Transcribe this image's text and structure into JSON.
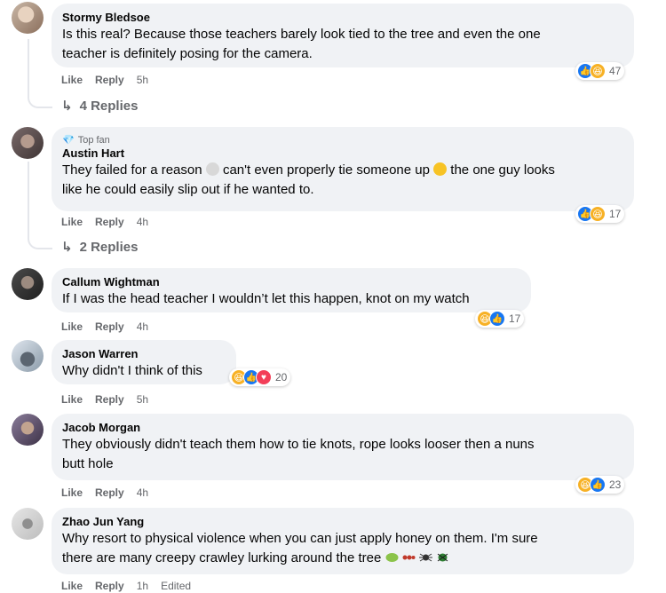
{
  "comments": [
    {
      "author": "Stormy Bledsoe",
      "lines": [
        "Is this real? Because those teachers barely look tied to the tree and even the one",
        "teacher is definitely posing for the camera."
      ],
      "like": "Like",
      "reply": "Reply",
      "time": "5h",
      "reaction_count": "47",
      "reactions": [
        "like-reaction",
        "haha-reaction"
      ],
      "replies": "4 Replies"
    },
    {
      "badge": "Top fan",
      "author": "Austin Hart",
      "line1_a": "They failed for a reason",
      "line1_b": "can't even properly tie someone up",
      "line1_c": "the one guy looks",
      "line2": "like he could easily slip out if he wanted to.",
      "like": "Like",
      "reply": "Reply",
      "time": "4h",
      "reaction_count": "17",
      "reactions": [
        "like-reaction",
        "haha-reaction"
      ],
      "replies": "2 Replies"
    },
    {
      "author": "Callum Wightman",
      "text": "If I was the head teacher I wouldn’t let this happen, knot on my watch",
      "like": "Like",
      "reply": "Reply",
      "time": "4h",
      "reaction_count": "17",
      "reactions": [
        "haha-reaction",
        "like-reaction"
      ]
    },
    {
      "author": "Jason Warren",
      "text": "Why didn't I think of this",
      "like": "Like",
      "reply": "Reply",
      "time": "5h",
      "reaction_count": "20",
      "reactions": [
        "haha-reaction",
        "like-reaction",
        "love-reaction"
      ]
    },
    {
      "author": "Jacob Morgan",
      "lines": [
        "They obviously didn't teach them how to tie knots, rope looks looser then a nuns",
        "butt hole"
      ],
      "like": "Like",
      "reply": "Reply",
      "time": "4h",
      "reaction_count": "23",
      "reactions": [
        "haha-reaction",
        "like-reaction"
      ]
    },
    {
      "author": "Zhao Jun Yang",
      "lines": [
        "Why resort to physical violence when you can just apply honey on them. I'm sure",
        "there are many creepy crawley lurking around the tree"
      ],
      "like": "Like",
      "reply": "Reply",
      "time": "1h",
      "edited": "Edited"
    }
  ],
  "colors": {
    "bubble": "#f0f2f5",
    "meta": "#65676b",
    "like_blue": "#1877f2",
    "haha_yellow": "#f7b125",
    "love_red": "#f33e58"
  }
}
